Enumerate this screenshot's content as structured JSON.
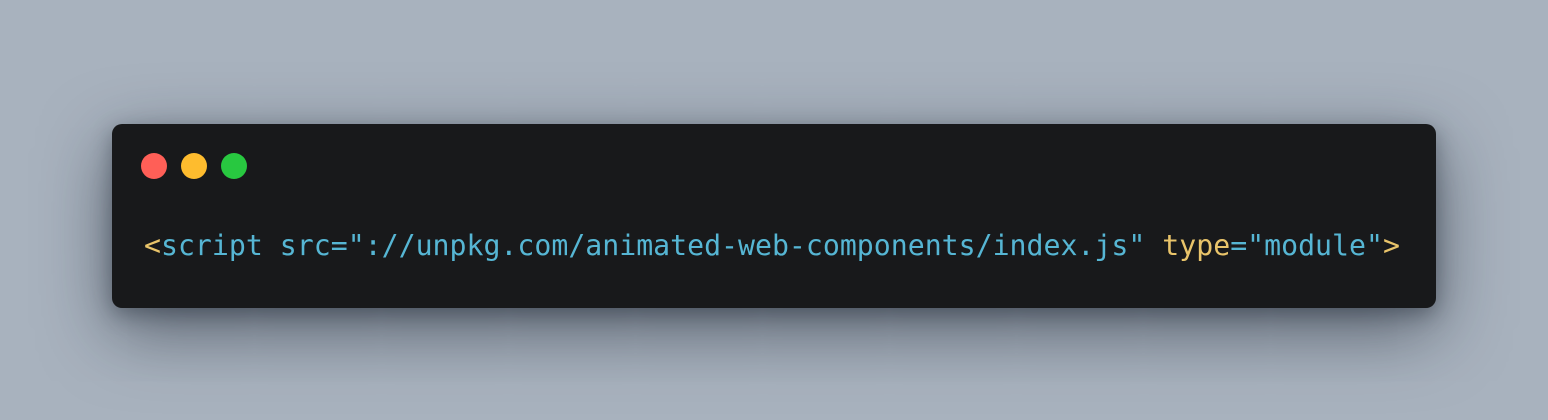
{
  "window": {
    "controls": {
      "close_color": "#ff5f57",
      "minimize_color": "#febc2e",
      "maximize_color": "#28c840"
    }
  },
  "code": {
    "open_bracket": "<",
    "tag": "script",
    "space1": " ",
    "attr1": "src",
    "eq1": "=",
    "val1": "\"://unpkg.com/animated-web-components/index.js\"",
    "space2": " ",
    "attr2": "type",
    "eq2": "=",
    "val2": "\"module\"",
    "close_bracket": ">"
  },
  "colors": {
    "background": "#a8b2be",
    "window_bg": "#18191b",
    "token_blue": "#56b6d4",
    "token_yellow": "#e9c46a"
  }
}
